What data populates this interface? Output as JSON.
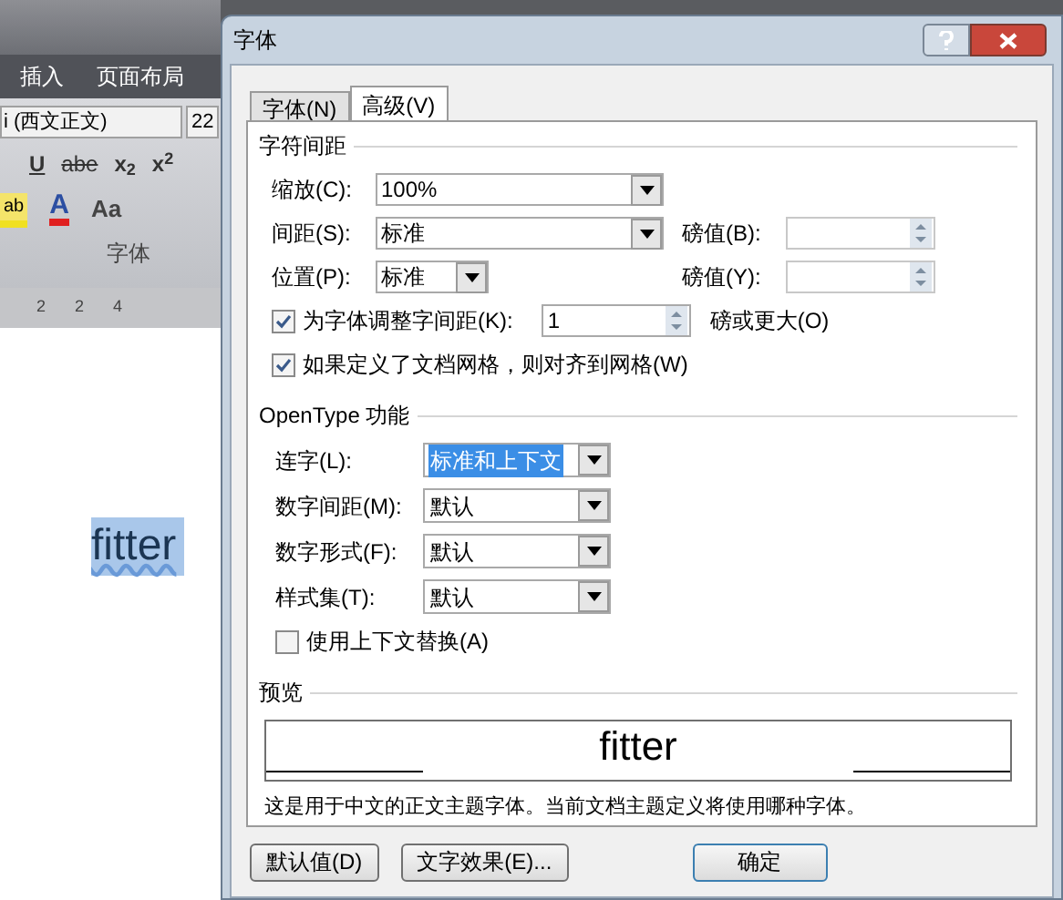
{
  "word": {
    "tabs": [
      "插入",
      "页面布局"
    ],
    "font_name": "i (西文正文)",
    "font_size": "22",
    "format_buttons": [
      {
        "kind": "underline",
        "label": "U"
      },
      {
        "kind": "strike",
        "label": "abe"
      },
      {
        "kind": "sub",
        "label": "x$_{2}$"
      },
      {
        "kind": "sup",
        "label": "x$^{2}$"
      }
    ],
    "color_buttons": [
      {
        "kind": "highlight",
        "label": "ab"
      },
      {
        "kind": "fontcolor",
        "label": "A"
      },
      {
        "kind": "case",
        "label": "Aa"
      }
    ],
    "group_label": "字体",
    "ruler_ticks": [
      "2",
      "2",
      "4"
    ],
    "document_text": "fitter"
  },
  "dialog": {
    "title": "字体",
    "tabs": [
      {
        "label": "字体(N)",
        "selected": false
      },
      {
        "label": "高级(V)",
        "selected": true
      }
    ],
    "char_spacing": {
      "title": "字符间距",
      "scale": {
        "label": "缩放(C):",
        "value": "100%"
      },
      "spacing": {
        "label": "间距(S):",
        "value": "标准",
        "pt_label": "磅值(B):"
      },
      "position": {
        "label": "位置(P):",
        "value": "标准",
        "pt_label": "磅值(Y):"
      },
      "kerning": {
        "checked": true,
        "label": "为字体调整字间距(K):",
        "value": "1",
        "suffix": "磅或更大(O)"
      },
      "grid": {
        "checked": true,
        "label": "如果定义了文档网格，则对齐到网格(W)"
      }
    },
    "opentype": {
      "title": "OpenType 功能",
      "selects": [
        {
          "label": "连字(L):",
          "value": "标准和上下文",
          "selected": true
        },
        {
          "label": "数字间距(M):",
          "value": "默认",
          "selected": false
        },
        {
          "label": "数字形式(F):",
          "value": "默认",
          "selected": false
        },
        {
          "label": "样式集(T):",
          "value": "默认",
          "selected": false
        }
      ],
      "contextual": {
        "checked": false,
        "label": "使用上下文替换(A)"
      }
    },
    "preview": {
      "title": "预览",
      "sample": "fitter",
      "note": "这是用于中文的正文主题字体。当前文档主题定义将使用哪种字体。"
    },
    "buttons": [
      {
        "label": "默认值(D)",
        "default": false
      },
      {
        "label": "文字效果(E)...",
        "default": false
      },
      {
        "label": "确定",
        "default": true
      }
    ]
  }
}
